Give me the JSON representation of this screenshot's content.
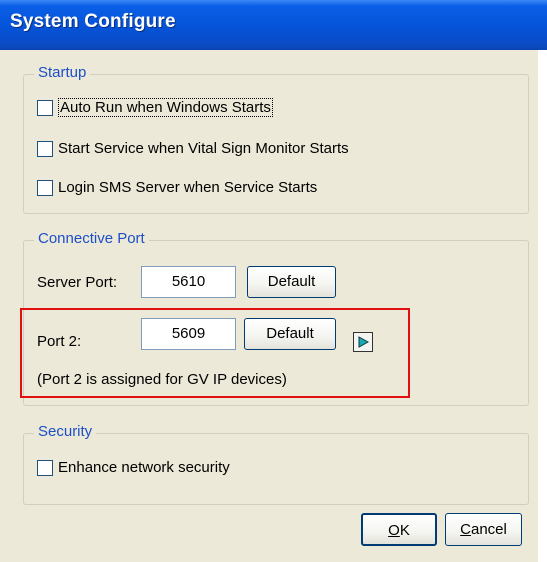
{
  "window": {
    "title": "System Configure"
  },
  "startup": {
    "legend": "Startup",
    "options": [
      {
        "label": "Auto Run when Windows Starts",
        "checked": false
      },
      {
        "label": "Start Service when Vital Sign Monitor Starts",
        "checked": false
      },
      {
        "label": "Login SMS Server when Service Starts",
        "checked": false
      }
    ]
  },
  "port": {
    "legend": "Connective Port",
    "server_port_label": "Server Port:",
    "server_port_value": "5610",
    "port2_label": "Port 2:",
    "port2_value": "5609",
    "default_label": "Default",
    "note": "(Port 2 is assigned for GV IP devices)",
    "arrow_icon": "play-arrow-icon",
    "highlight_color": "#e01010"
  },
  "security": {
    "legend": "Security",
    "option_label": "Enhance network security",
    "checked": false
  },
  "footer": {
    "ok_mnemonic": "O",
    "ok_rest": "K",
    "cancel_mnemonic": "C",
    "cancel_rest": "ancel"
  },
  "colors": {
    "titlebar": "#0553d8",
    "legend_text": "#1c4fc7",
    "dialog_bg": "#ece9d8",
    "arrow_fill": "#1aa9b8"
  }
}
